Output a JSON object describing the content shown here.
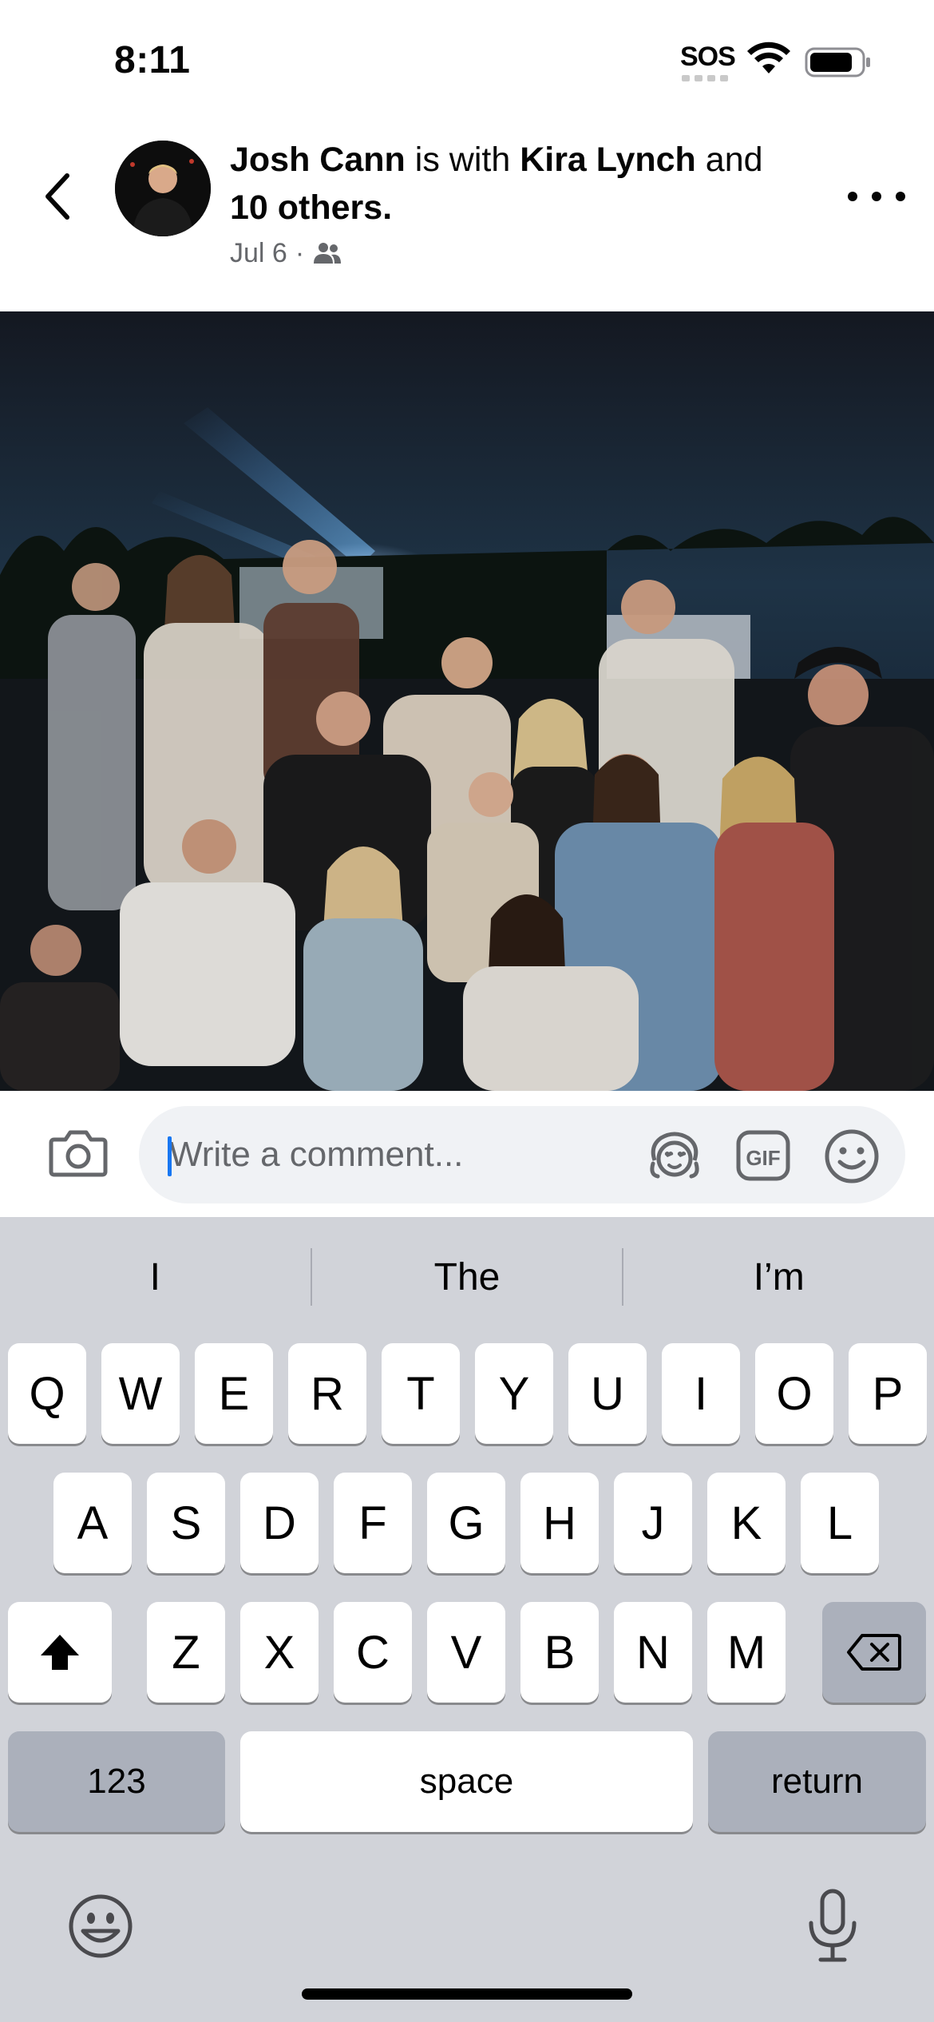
{
  "status_bar": {
    "time": "8:11",
    "sos": "SOS"
  },
  "post": {
    "author": "Josh Cann",
    "with_text": " is with ",
    "tagged": "Kira Lynch",
    "and_text": " and ",
    "others": "10 others.",
    "date": "Jul 6",
    "separator": "·",
    "audience_icon": "friends-icon"
  },
  "comment": {
    "placeholder": "Write a comment...",
    "value": ""
  },
  "keyboard": {
    "predictions": [
      "I",
      "The",
      "I’m"
    ],
    "row1": [
      "Q",
      "W",
      "E",
      "R",
      "T",
      "Y",
      "U",
      "I",
      "O",
      "P"
    ],
    "row2": [
      "A",
      "S",
      "D",
      "F",
      "G",
      "H",
      "J",
      "K",
      "L"
    ],
    "row3": [
      "Z",
      "X",
      "C",
      "V",
      "B",
      "N",
      "M"
    ],
    "numbers_label": "123",
    "space_label": "space",
    "return_label": "return"
  },
  "colors": {
    "accent": "#1877f2",
    "keyboard_bg": "#d1d3d9",
    "special_key": "#abb0bb",
    "secondary_text": "#65676b"
  }
}
